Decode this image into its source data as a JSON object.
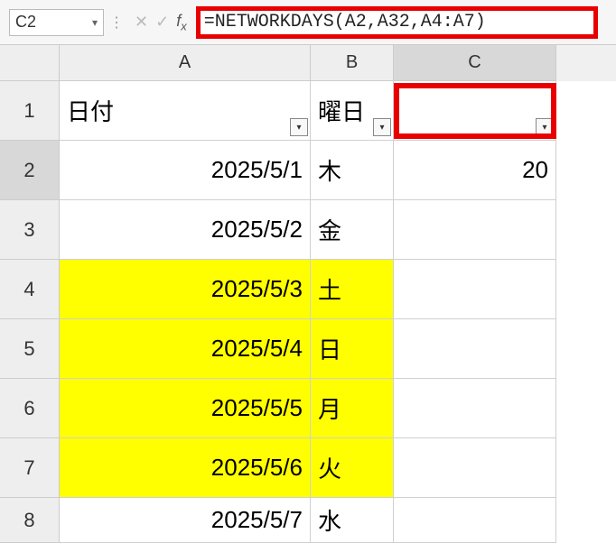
{
  "name_box": "C2",
  "formula": "=NETWORKDAYS(A2,A32,A4:A7)",
  "columns": [
    "A",
    "B",
    "C"
  ],
  "headers": {
    "A": "日付",
    "B": "曜日",
    "C": ""
  },
  "rows": [
    {
      "num": "1",
      "A": "日付",
      "B": "曜日",
      "C": "",
      "is_header": true
    },
    {
      "num": "2",
      "A": "2025/5/1",
      "B": "木",
      "C": "20",
      "selected": true
    },
    {
      "num": "3",
      "A": "2025/5/2",
      "B": "金",
      "C": ""
    },
    {
      "num": "4",
      "A": "2025/5/3",
      "B": "土",
      "C": "",
      "yellow": true
    },
    {
      "num": "5",
      "A": "2025/5/4",
      "B": "日",
      "C": "",
      "yellow": true
    },
    {
      "num": "6",
      "A": "2025/5/5",
      "B": "月",
      "C": "",
      "yellow": true
    },
    {
      "num": "7",
      "A": "2025/5/6",
      "B": "火",
      "C": "",
      "yellow": true
    },
    {
      "num": "8",
      "A": "2025/5/7",
      "B": "水",
      "C": ""
    }
  ],
  "chart_data": {
    "type": "table",
    "title": "",
    "columns": [
      "日付",
      "曜日",
      ""
    ],
    "rows": [
      [
        "2025/5/1",
        "木",
        20
      ],
      [
        "2025/5/2",
        "金",
        null
      ],
      [
        "2025/5/3",
        "土",
        null
      ],
      [
        "2025/5/4",
        "日",
        null
      ],
      [
        "2025/5/5",
        "月",
        null
      ],
      [
        "2025/5/6",
        "火",
        null
      ],
      [
        "2025/5/7",
        "水",
        null
      ]
    ],
    "formula_cell": "C2",
    "formula": "=NETWORKDAYS(A2,A32,A4:A7)",
    "result": 20,
    "highlighted_rows": [
      "2025/5/3",
      "2025/5/4",
      "2025/5/5",
      "2025/5/6"
    ]
  }
}
